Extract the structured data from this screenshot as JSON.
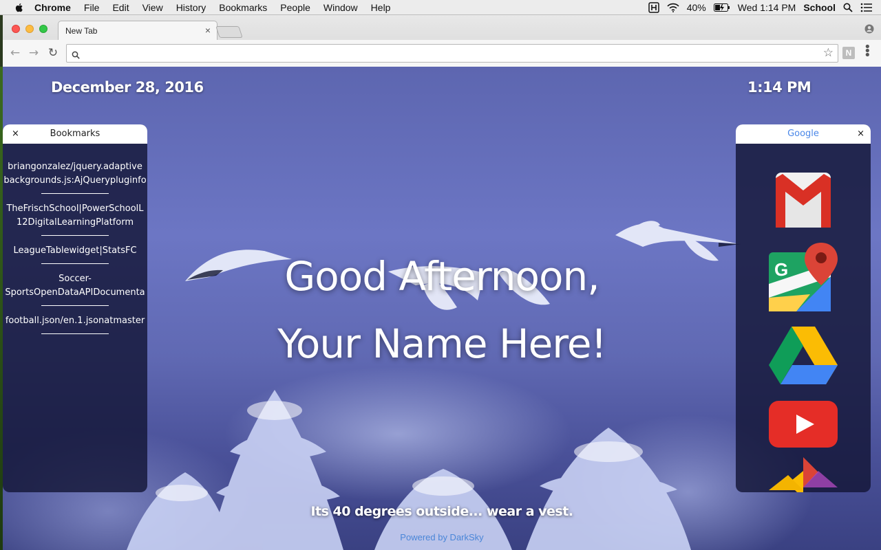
{
  "menubar": {
    "app_name": "Chrome",
    "items": [
      "File",
      "Edit",
      "View",
      "History",
      "Bookmarks",
      "People",
      "Window",
      "Help"
    ],
    "battery": "40%",
    "clock": "Wed 1:14 PM",
    "user": "School"
  },
  "browser": {
    "tab_title": "New Tab",
    "tab_close": "×",
    "omnibox_value": "",
    "extension_label": "N"
  },
  "page": {
    "date": "December 28, 2016",
    "time": "1:14 PM",
    "greeting_line1": "Good Afternoon,",
    "greeting_line2": "Your Name Here!",
    "weather": "Its 40 degrees outside... wear a vest.",
    "powered_by": "Powered by DarkSky"
  },
  "bookmarks_panel": {
    "title": "Bookmarks",
    "close": "×",
    "items": [
      {
        "line1": "briangonzalez/jquery.adaptive",
        "line2": "backgrounds.js:AjQuerypluginfo"
      },
      {
        "line1": "TheFrischSchool|PowerSchoolL",
        "line2": "12DigitalLearningPlatform"
      },
      {
        "line1": "LeagueTablewidget|StatsFC",
        "line2": ""
      },
      {
        "line1": "Soccer-",
        "line2": "SportsOpenDataAPIDocumenta"
      },
      {
        "line1": "football.json/en.1.jsonatmaster",
        "line2": ""
      }
    ]
  },
  "apps_panel": {
    "title": "Google",
    "close": "×",
    "apps": [
      "gmail-icon",
      "google-maps-icon",
      "google-drive-icon",
      "youtube-icon",
      "google-photos-icon"
    ]
  },
  "colors": {
    "traffic_close": "#fc5753",
    "traffic_min": "#fdbc40",
    "traffic_max": "#33c748",
    "google_title": "#4a87e8",
    "powered_link": "#4a86d8"
  }
}
